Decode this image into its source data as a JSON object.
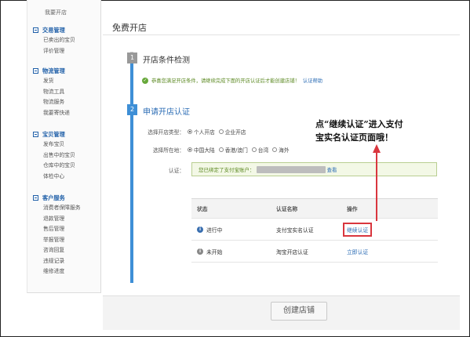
{
  "sidebar": {
    "top_item": "我要开店",
    "groups": [
      {
        "title": "交易管理",
        "items": [
          "已卖出的宝贝",
          "评价管理"
        ]
      },
      {
        "title": "物流管理",
        "items": [
          "发货",
          "物流工具",
          "物流服务",
          "我要寄快递"
        ]
      },
      {
        "title": "宝贝管理",
        "items": [
          "发布宝贝",
          "出售中的宝贝",
          "仓库中的宝贝",
          "体检中心"
        ]
      },
      {
        "title": "客户服务",
        "items": [
          "消费者保障服务",
          "退款管理",
          "售后管理",
          "举报管理",
          "咨询回复",
          "违规记录",
          "维修进度"
        ]
      }
    ]
  },
  "header": {
    "title": "免费开店"
  },
  "step1": {
    "number": "1",
    "title": "开店条件检测",
    "notice": "恭喜您满足开店条件，请继续完成下面的开店认证后才能创建店铺！",
    "help_link": "认证帮助"
  },
  "step2": {
    "number": "2",
    "title": "申请开店认证"
  },
  "form": {
    "shop_type_label": "选择开店类型：",
    "shop_type_options": [
      "个人开店",
      "企业开店"
    ],
    "region_label": "选择所在地：",
    "region_options": [
      "中国大陆",
      "香港/澳门",
      "台湾",
      "海外"
    ],
    "auth_label": "认证：",
    "auth_text": "您已绑定了支付宝账户：",
    "auth_link": "查看"
  },
  "table": {
    "headers": [
      "状态",
      "认证名称",
      "操作"
    ],
    "rows": [
      {
        "status": "进行中",
        "name": "支付宝实名认证",
        "action": "继续认证"
      },
      {
        "status": "未开始",
        "name": "淘宝开店认证",
        "action": "立即认证"
      }
    ]
  },
  "annotation": {
    "line1": "点“继续认证”进入支付",
    "line2": "宝实名认证页面哦！"
  },
  "create_button": "创建店铺",
  "colors": {
    "accent": "#3e8fd6",
    "link": "#2c6db5",
    "success": "#5d8a24",
    "highlight": "#d9363e"
  }
}
